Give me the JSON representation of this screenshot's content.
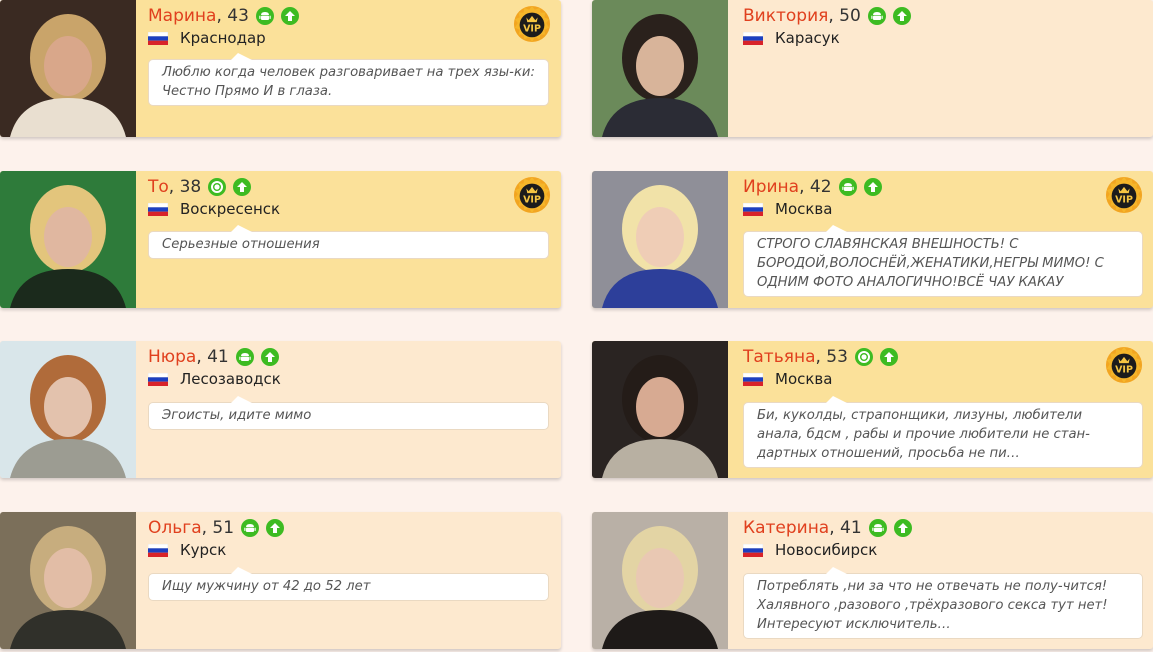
{
  "cards": [
    {
      "name": "Марина",
      "age": ", 43",
      "device": "android",
      "city": "Краснодар",
      "text": "Люблю когда человек разговаривает на трех язы-ки: Честно Прямо И в глаза.",
      "vip": true,
      "vip_label": "VIP"
    },
    {
      "name": "Виктория",
      "age": ", 50",
      "device": "android",
      "city": "Карасук",
      "text": "",
      "vip": false,
      "vip_label": ""
    },
    {
      "name": "То",
      "age": ", 38",
      "device": "online",
      "city": "Воскресенск",
      "text": "Серьезные отношения",
      "vip": true,
      "vip_label": "VIP"
    },
    {
      "name": "Ирина",
      "age": ", 42",
      "device": "android",
      "city": "Москва",
      "text": "СТРОГО СЛАВЯНСКАЯ ВНЕШНОСТЬ! С БОРОДОЙ,ВОЛОСНЁЙ,ЖЕНАТИКИ,НЕГРЫ МИМО! С ОДНИМ ФОТО АНАЛОГИЧНО!ВСЁ ЧАУ КАКАУ",
      "vip": true,
      "vip_label": "VIP"
    },
    {
      "name": "Нюра",
      "age": ", 41",
      "device": "android",
      "city": "Лесозаводск",
      "text": "Эгоисты, идите мимо",
      "vip": false,
      "vip_label": ""
    },
    {
      "name": "Татьяна",
      "age": ", 53",
      "device": "online",
      "city": "Москва",
      "text": "Би, куколды, страпонщики, лизуны, любители анала, бдсм , рабы и прочие любители не стан-дартных отношений, просьба не пи…",
      "vip": true,
      "vip_label": "VIP"
    },
    {
      "name": "Ольга",
      "age": ", 51",
      "device": "android",
      "city": "Курск",
      "text": "Ищу мужчину от 42 до 52 лет",
      "vip": false,
      "vip_label": ""
    },
    {
      "name": "Катерина",
      "age": ", 41",
      "device": "android",
      "city": "Новосибирск",
      "text": "Потреблять ,ни за что не отвечать не полу-чится! Халявного ,разового ,трёхразового секса тут нет! Интересуют исключитель…",
      "vip": false,
      "vip_label": ""
    }
  ],
  "icons": {
    "android": "android-icon",
    "online": "online-status-icon",
    "up": "raise-arrow-icon",
    "flag": "russia-flag-icon",
    "vip": "vip-crown-badge"
  },
  "colors": {
    "name": "#e0401e",
    "vip_card": "#fbe19a",
    "card": "#fde9cf",
    "badge_green": "#3dbb22"
  }
}
